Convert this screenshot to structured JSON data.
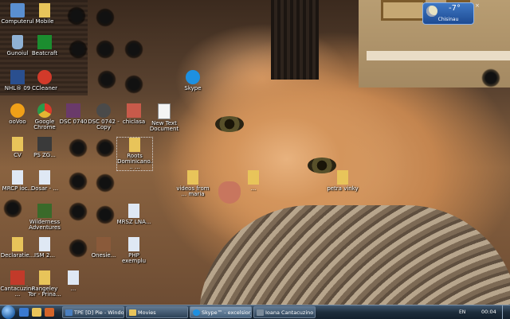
{
  "desktop": {
    "icons": [
      {
        "label": "Computerul",
        "icon": "computer-icon",
        "color": "#5a8fd0"
      },
      {
        "label": "Gunoiul",
        "icon": "recycle-bin-icon",
        "color": "#8fb1d4"
      },
      {
        "label": "NHL® 09",
        "icon": "game-icon",
        "color": "#2a4f8f"
      },
      {
        "label": "ooVoo",
        "icon": "oovoo-icon",
        "color": "#f0a018"
      },
      {
        "label": "CV",
        "icon": "folder-icon",
        "color": "#e8c45a"
      },
      {
        "label": "MRCP ioc...",
        "icon": "document-icon",
        "color": "#dfe8f4"
      },
      {
        "label": "Declaratie...",
        "icon": "document-icon",
        "color": "#e8c45a"
      },
      {
        "label": "Cantacuzino...",
        "icon": "shortcut-icon",
        "color": "#c23a2a"
      },
      {
        "label": "Mobile",
        "icon": "folder-icon",
        "color": "#e8c45a"
      },
      {
        "label": "Beatcraft",
        "icon": "beatcraft-icon",
        "color": "#1b8d2f"
      },
      {
        "label": "CCleaner",
        "icon": "ccleaner-icon",
        "color": "#d23a2a"
      },
      {
        "label": "Google Chrome",
        "icon": "chrome-icon",
        "color": "#e4b432"
      },
      {
        "label": "PS ZG...",
        "icon": "image-icon",
        "color": "#3a3a3a"
      },
      {
        "label": "Dosar - ...",
        "icon": "document-icon",
        "color": "#dfe8f4"
      },
      {
        "label": "Wilderness Adventures",
        "icon": "game-icon",
        "color": "#3a6a2a"
      },
      {
        "label": "ISM 2...",
        "icon": "document-icon",
        "color": "#dfe8f4"
      },
      {
        "label": "Rangeley Tor - Prina...",
        "icon": "folder-icon",
        "color": "#e8c45a"
      },
      {
        "label": "DSC 0740",
        "icon": "image-icon",
        "color": "#6a3a6a"
      },
      {
        "label": "DSC 0742 - Copy",
        "icon": "image-icon",
        "color": "#4a4a4a"
      },
      {
        "label": "Onesie...",
        "icon": "image-icon",
        "color": "#8a5a3a"
      },
      {
        "label": "...",
        "icon": "document-icon",
        "color": "#dfe8f4"
      },
      {
        "label": "chiclasa",
        "icon": "image-icon",
        "color": "#c85a4a"
      },
      {
        "label": "Roots Dominicano... ...",
        "icon": "folder-icon",
        "color": "#e8c45a"
      },
      {
        "label": "MRSZ LNA...",
        "icon": "document-icon",
        "color": "#dfe8f4"
      },
      {
        "label": "PHP exemplu",
        "icon": "document-icon",
        "color": "#dfe8f4"
      },
      {
        "label": "Skype",
        "icon": "skype-icon",
        "color": "#1e90e0"
      },
      {
        "label": "New Text Document",
        "icon": "text-document-icon",
        "color": "#f4f4f4"
      },
      {
        "label": "videos from ... maria",
        "icon": "folder-icon",
        "color": "#e8c45a"
      },
      {
        "label": "...",
        "icon": "folder-icon",
        "color": "#e8c45a"
      },
      {
        "label": "petra vinky",
        "icon": "folder-icon",
        "color": "#e8c45a"
      }
    ],
    "weather": {
      "temp": "-7°",
      "city": "Chisinau"
    }
  },
  "taskbar": {
    "tasks": [
      {
        "label": "TPE [D] Pie - Window...",
        "color": "#4a7fc0"
      },
      {
        "label": "Movies",
        "color": "#e8c45a"
      },
      {
        "label": "Skype™ - excelsior_5...",
        "color": "#1e90e0"
      },
      {
        "label": "Ioana Cantacuzino - ...",
        "color": "#7a8a9a"
      }
    ],
    "lang": "EN",
    "clock": "00:04"
  }
}
